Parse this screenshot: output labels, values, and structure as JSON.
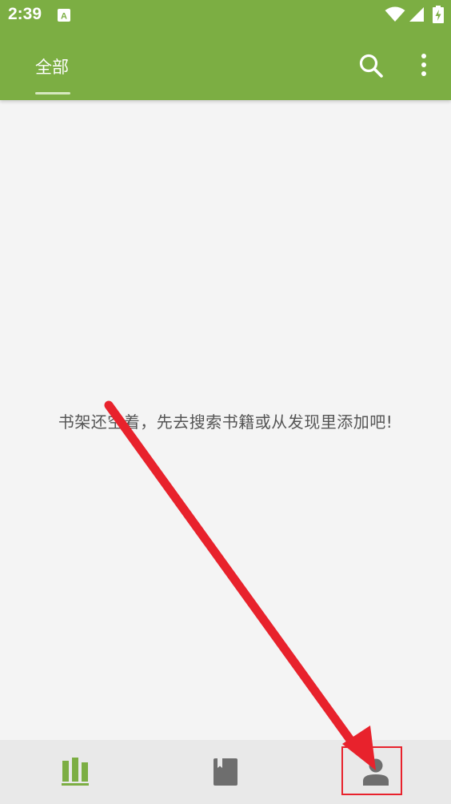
{
  "status_bar": {
    "time": "2:39",
    "icons": [
      "text-a-icon",
      "wifi-icon",
      "signal-icon",
      "battery-charging-icon"
    ]
  },
  "app_bar": {
    "tab_label": "全部",
    "actions": [
      "search-icon",
      "more-vert-icon"
    ]
  },
  "shelf": {
    "empty_message": "书架还空着，先去搜索书籍或从发现里添加吧!"
  },
  "bottom_nav": {
    "items": [
      {
        "icon": "bookshelf-icon",
        "selected": true
      },
      {
        "icon": "bookmark-book-icon",
        "selected": false
      },
      {
        "icon": "person-icon",
        "selected": false
      }
    ]
  },
  "colors": {
    "primary": "#7cae43",
    "background": "#f4f4f4",
    "nav_background": "#e9e9e9",
    "icon_inactive": "#6e6e6e",
    "annotation_red": "#e8222c"
  }
}
